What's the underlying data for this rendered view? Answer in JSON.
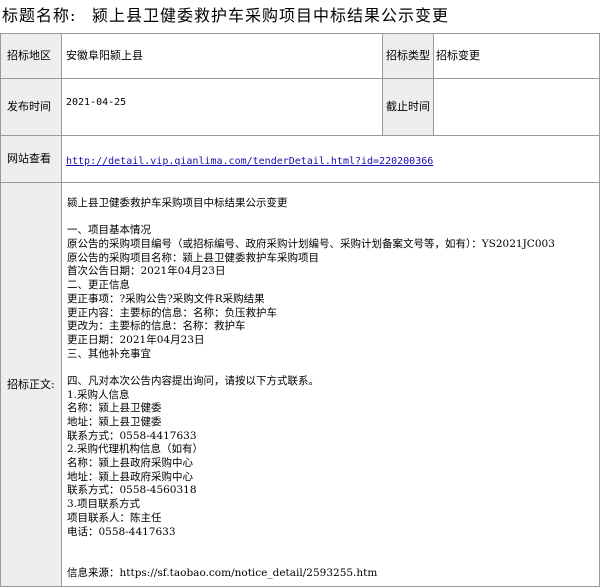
{
  "title": {
    "label": "标题名称:",
    "text": "颍上县卫健委救护车采购项目中标结果公示变更"
  },
  "fields": {
    "region_label": "招标地区",
    "region_value": "安徽阜阳颍上县",
    "type_label": "招标类型",
    "type_value": "招标变更",
    "publish_label": "发布时间",
    "publish_value": "2021-04-25",
    "deadline_label": "截止时间",
    "deadline_value": "",
    "url_label": "网站查看",
    "url_value": "http://detail.vip.qianlima.com/tenderDetail.html?id=220200366",
    "body_label": "招标正文:"
  },
  "body": {
    "heading": "颍上县卫健委救护车采购项目中标结果公示变更",
    "lines_a": [
      "一、项目基本情况",
      "原公告的采购项目编号（或招标编号、政府采购计划编号、采购计划备案文号等，如有）：YS2021JC003",
      "原公告的采购项目名称：颍上县卫健委救护车采购项目",
      "首次公告日期：2021年04月23日",
      "二、更正信息",
      "更正事项：?采购公告?采购文件R采购结果",
      "更正内容：主要标的信息：名称：负压救护车",
      "更改为：主要标的信息：名称：救护车",
      "更正日期：2021年04月23日",
      "三、其他补充事宜"
    ],
    "lines_b": [
      "四、凡对本次公告内容提出询问，请按以下方式联系。",
      "1.采购人信息",
      "名称：颍上县卫健委",
      "地址：颍上县卫健委",
      "联系方式：0558-4417633",
      "2.采购代理机构信息（如有）",
      "名称：颍上县政府采购中心",
      "地址：颍上县政府采购中心",
      "联系方式：0558-4560318",
      "3.项目联系方式",
      "项目联系人：陈主任",
      "电话：0558-4417633"
    ],
    "source": "信息来源：https://sf.taobao.com/notice_detail/2593255.htm"
  }
}
